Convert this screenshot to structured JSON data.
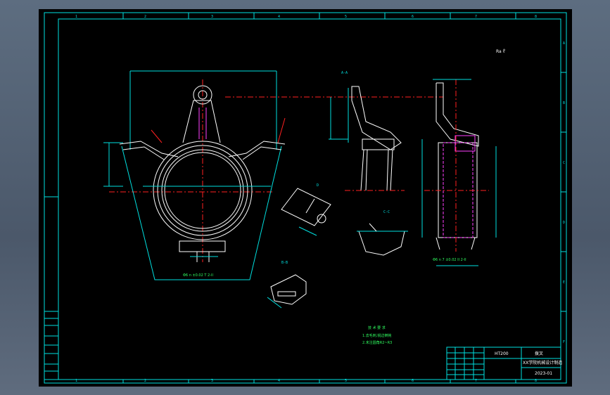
{
  "drawing": {
    "top_zone_letters": [
      "1",
      "2",
      "3",
      "4",
      "5",
      "6",
      "7",
      "8"
    ],
    "bottom_zone_letters": [
      "1",
      "2",
      "3",
      "4",
      "5",
      "6",
      "7",
      "8"
    ],
    "side_zone_letters": [
      "A",
      "B",
      "C",
      "D",
      "E",
      "F"
    ],
    "section_label_1": "A-A",
    "section_label_2": "B-B",
    "section_label_3": "C-C",
    "view_label": "D",
    "surface_note": "Ra  ∜",
    "front_note": "Φ6  n ±0.02 T 2-II",
    "side_note": "Φ6  n 7 ±0.02  II 2-II"
  },
  "tech_requirements": {
    "title": "技 术 要 求",
    "line1": "1.去毛刺,锐边倒钝",
    "line2": "2.未注圆角R2~R3"
  },
  "title_block": {
    "material": "HT200",
    "part_name": "拨叉",
    "school_line": "XX学院机械设计制造",
    "drawing_no": "2023-01"
  },
  "left_strip": {
    "cells": [
      "",
      "",
      "",
      "",
      "",
      "",
      ""
    ]
  },
  "colors": {
    "outline": "#00e0e0",
    "geometry": "#ffffff",
    "centerline": "#ff2020",
    "hidden": "#ff40ff",
    "notes": "#30ff60"
  }
}
